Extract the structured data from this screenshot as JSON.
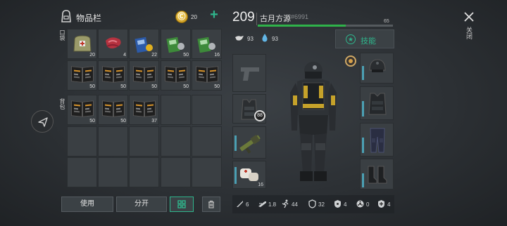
{
  "header": {
    "inventory_title": "物品栏",
    "coins": "20",
    "level": "209",
    "player_name": "古月方源",
    "player_tag": "#6991",
    "xp_value": "65",
    "xp_fraction": 0.65,
    "hunger": "93",
    "thirst": "93",
    "skills_label": "技能",
    "close_label": "关闭"
  },
  "sections": {
    "backpack_label": "背包",
    "pocket_label": "口袋"
  },
  "top_items": [
    {
      "icon": "medkit-bag-icon",
      "count": "20"
    },
    {
      "icon": "raw-meat-icon",
      "count": "4"
    },
    {
      "icon": "blue-book-icon",
      "count": "22"
    },
    {
      "icon": "green-book-icon",
      "count": "50"
    },
    {
      "icon": "green-book-icon",
      "count": "16"
    },
    {
      "icon": "recipe-book-icon",
      "count": "50"
    },
    {
      "icon": "recipe-book-icon",
      "count": "50"
    },
    {
      "icon": "recipe-book-icon",
      "count": "50"
    },
    {
      "icon": "recipe-book-icon",
      "count": "50"
    },
    {
      "icon": "recipe-book-icon",
      "count": "50"
    }
  ],
  "bag_items": [
    {
      "icon": "recipe-book-icon",
      "count": "50"
    },
    {
      "icon": "recipe-book-icon",
      "count": "50"
    },
    {
      "icon": "recipe-book-icon",
      "count": "37"
    }
  ],
  "equipment": {
    "vest_badge": "88",
    "bandage_count": "16"
  },
  "buttons": {
    "use": "使用",
    "split": "分开"
  },
  "stats": [
    {
      "icon": "melee-icon",
      "value": "6"
    },
    {
      "icon": "gun-icon",
      "value": "1.8"
    },
    {
      "icon": "run-icon",
      "value": "44"
    },
    {
      "icon": "shield-icon",
      "value": "32"
    },
    {
      "icon": "radiation-shield-icon",
      "value": "4"
    },
    {
      "icon": "biohazard-icon",
      "value": "0"
    },
    {
      "icon": "armor-plus-icon",
      "value": "4"
    }
  ],
  "colors": {
    "xp_bar": "#2fb24a",
    "accent_teal": "#2fb58c",
    "slot_bar": "#4b9fb3",
    "coin": "#e0b020"
  }
}
